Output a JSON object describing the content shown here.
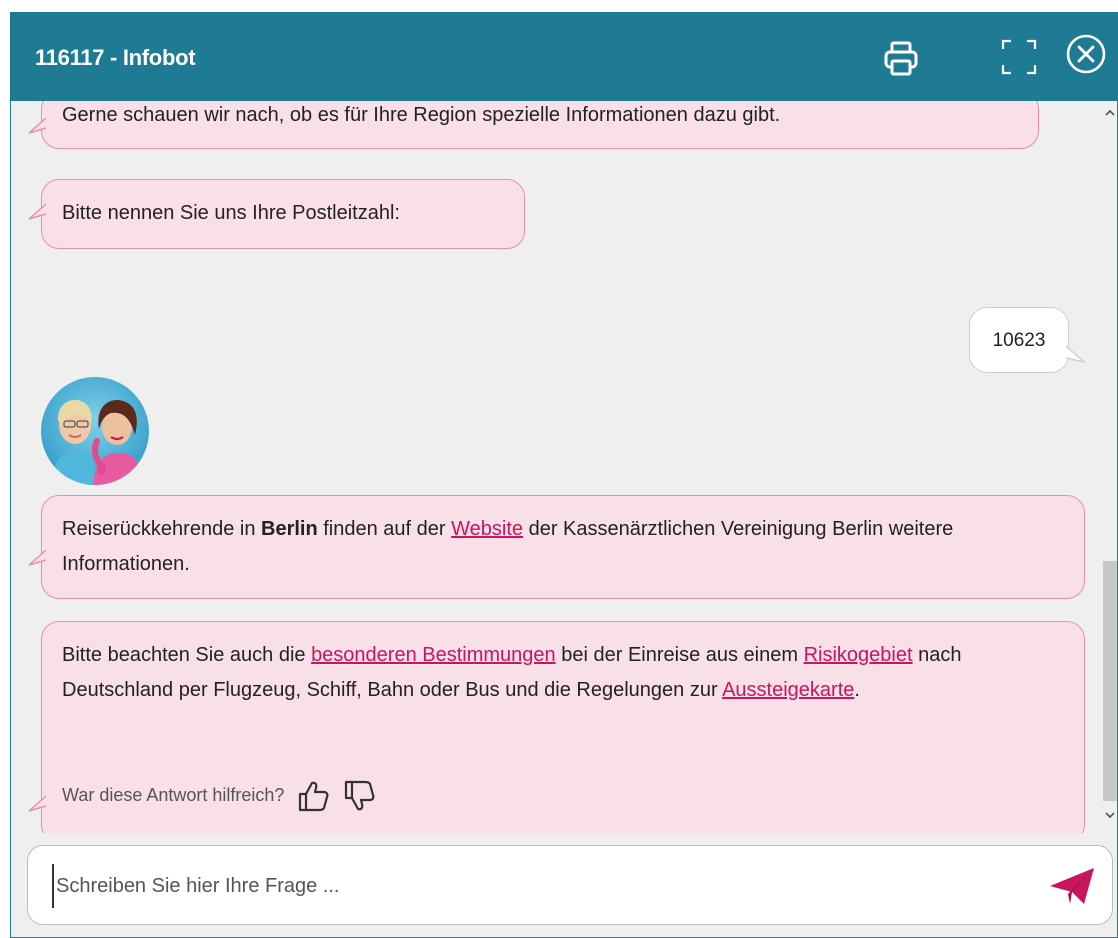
{
  "header": {
    "title": "116117 - Infobot",
    "print_icon": "printer-icon",
    "fullscreen_icon": "fullscreen-icon",
    "close_icon": "close-circle-icon",
    "bg_color": "#1f7a93"
  },
  "messages": {
    "m1": "Gerne schauen wir nach, ob es für Ihre Region spezielle Informationen dazu gibt.",
    "m2": "Bitte nennen Sie uns Ihre Postleitzahl:",
    "user_reply": "10623",
    "m3": {
      "pre": "Reiserückkehrende in ",
      "bold": "Berlin",
      "mid": " finden auf der ",
      "link": "Website",
      "post": " der Kassenärztlichen Vereinigung Berlin weitere Informationen."
    },
    "m4": {
      "t1": "Bitte beachten Sie auch die ",
      "link1": "besonderen Bestimmungen",
      "t2": " bei der Einreise aus einem ",
      "link2": "Risikogebiet",
      "t3": " nach Deutschland per Flugzeug, Schiff, Bahn oder Bus und die Regelungen zur ",
      "link3": "Aussteigekarte",
      "t4": "."
    },
    "feedback_question": "War diese Antwort hilfreich?"
  },
  "bot_avatar_icon": "bot-avatar-two-women-icon",
  "input": {
    "placeholder": "Schreiben Sie hier Ihre Frage ...",
    "value": "",
    "send_icon": "send-paper-plane-icon"
  },
  "colors": {
    "bubble_bg": "#f9dfe7",
    "bubble_border": "#e890aa",
    "link": "#c8155e",
    "chat_bg": "#efefef"
  }
}
